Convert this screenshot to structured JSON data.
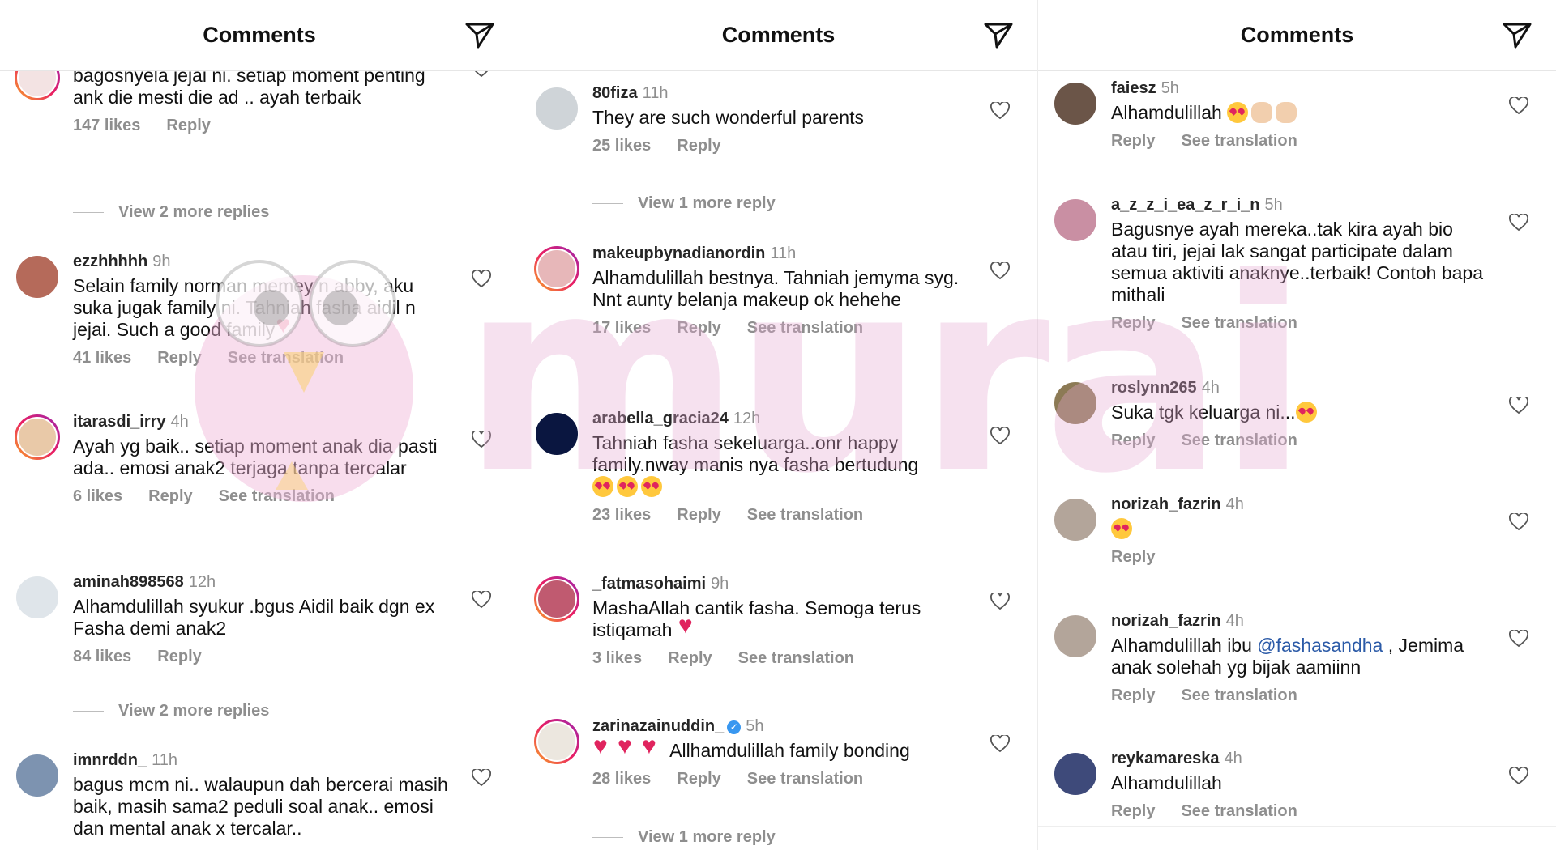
{
  "panels": [
    {
      "title": "Comments",
      "comments": [
        {
          "text": "bagosnyela jejai ni. setiap moment penting ank die mesti die ad .. ayah terbaik",
          "likes": "147 likes",
          "reply": "Reply"
        },
        {
          "username": "ezzhhhhh",
          "time": "9h",
          "text": "Selain family norman memey n abby, aku suka jugak family ni. Tahniah fasha aidil n jejai. Such a good family",
          "likes": "41 likes",
          "reply": "Reply",
          "translation": "See translation"
        },
        {
          "username": "itarasdi_irry",
          "time": "4h",
          "text": "Ayah yg baik.. setiap moment anak dia pasti ada.. emosi anak2 terjaga tanpa tercalar",
          "likes": "6 likes",
          "reply": "Reply",
          "translation": "See translation"
        },
        {
          "username": "aminah898568",
          "time": "12h",
          "text": "Alhamdulillah syukur .bgus Aidil baik dgn ex Fasha demi anak2",
          "likes": "84 likes",
          "reply": "Reply"
        },
        {
          "username": "imnrddn_",
          "time": "11h",
          "text": "bagus mcm ni.. walaupun dah bercerai masih baik, masih sama2 peduli soal anak.. emosi dan mental anak x tercalar.."
        }
      ],
      "more_replies": [
        "View 2 more replies",
        "View 2 more replies"
      ]
    },
    {
      "title": "Comments",
      "comments": [
        {
          "username": "80fiza",
          "time": "11h",
          "text": "They are such wonderful parents",
          "likes": "25 likes",
          "reply": "Reply"
        },
        {
          "username": "makeupbynadianordin",
          "time": "11h",
          "text": "Alhamdulillah bestnya. Tahniah jemyma syg. Nnt aunty belanja makeup ok hehehe",
          "likes": "17 likes",
          "reply": "Reply",
          "translation": "See translation"
        },
        {
          "username": "arabella_gracia24",
          "time": "12h",
          "text": "Tahniah fasha sekeluarga..onr happy family.nway manis nya fasha bertudung",
          "likes": "23 likes",
          "reply": "Reply",
          "translation": "See translation"
        },
        {
          "username": "_fatmasohaimi",
          "time": "9h",
          "text": "MashaAllah cantik fasha. Semoga terus istiqamah",
          "likes": "3 likes",
          "reply": "Reply",
          "translation": "See translation"
        },
        {
          "username": "zarinazainuddin_",
          "time": "5h",
          "text": "Allhamdulillah family bonding",
          "likes": "28 likes",
          "reply": "Reply",
          "translation": "See translation"
        }
      ],
      "more_replies": [
        "View 1 more reply",
        "View 1 more reply"
      ]
    },
    {
      "title": "Comments",
      "comments": [
        {
          "username": "faiesz",
          "time": "5h",
          "text": "Alhamdulillah",
          "reply": "Reply",
          "translation": "See translation"
        },
        {
          "username": "a_z_z_i_ea_z_r_i_n",
          "time": "5h",
          "text": "Bagusnye ayah mereka..tak kira ayah bio atau tiri, jejai lak sangat participate dalam semua aktiviti anaknye..terbaik! Contoh bapa mithali",
          "reply": "Reply",
          "translation": "See translation"
        },
        {
          "username": "roslynn265",
          "time": "4h",
          "text": "Suka tgk keluarga ni...",
          "reply": "Reply",
          "translation": "See translation"
        },
        {
          "username": "norizah_fazrin",
          "time": "4h",
          "reply": "Reply"
        },
        {
          "username": "norizah_fazrin",
          "time": "4h",
          "text_before": "Alhamdulillah ibu ",
          "mention": "@fashasandha",
          "text_after": " , Jemima anak solehah yg bijak aamiinn",
          "reply": "Reply",
          "translation": "See translation"
        },
        {
          "username": "reykamareska",
          "time": "4h",
          "text": "Alhamdulillah",
          "reply": "Reply",
          "translation": "See translation"
        }
      ]
    }
  ],
  "watermark": "murai",
  "colors": {
    "story_ring": "#e91e63",
    "meta_gray": "#8e8e8e",
    "mention": "#2b5aa7",
    "verified": "#3897f0",
    "watermark": "#e6aad2"
  }
}
